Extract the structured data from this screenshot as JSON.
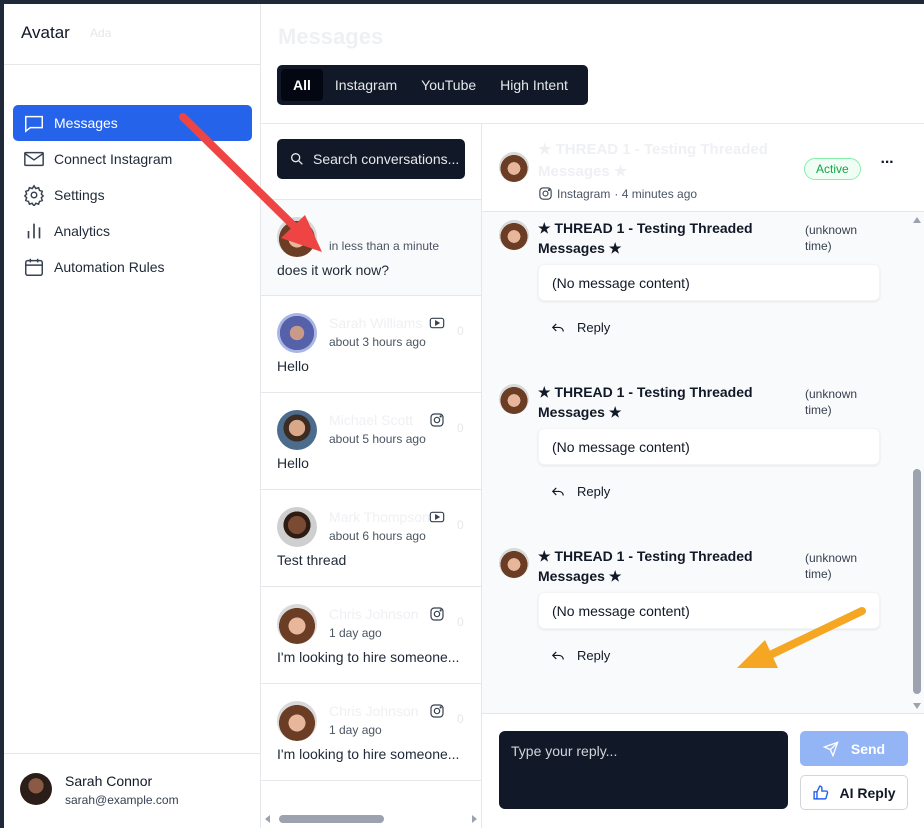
{
  "sidebar": {
    "brand": "Avatar",
    "brand_faint": "Ada",
    "nav": [
      {
        "label": "Messages",
        "icon": "chat-icon",
        "active": true
      },
      {
        "label": "Connect Instagram",
        "icon": "mail-icon"
      },
      {
        "label": "Settings",
        "icon": "gear-icon"
      },
      {
        "label": "Analytics",
        "icon": "bar-chart-icon"
      },
      {
        "label": "Automation Rules",
        "icon": "calendar-icon"
      }
    ],
    "user": {
      "name": "Sarah Connor",
      "email": "sarah@example.com"
    }
  },
  "page": {
    "title": "Messages"
  },
  "filters": [
    "All",
    "Instagram",
    "YouTube",
    "High Intent"
  ],
  "search": {
    "placeholder": "Search conversations..."
  },
  "conversations": [
    {
      "name": "",
      "platform": "",
      "time": "in less than a minute",
      "preview": "does it work now?",
      "count": ""
    },
    {
      "name": "Sarah Williams",
      "platform": "youtube-icon",
      "time": "about 3 hours ago",
      "preview": "Hello",
      "count": "0"
    },
    {
      "name": "Michael Scott",
      "platform": "instagram-icon",
      "time": "about 5 hours ago",
      "preview": "Hello",
      "count": "0"
    },
    {
      "name": "Mark Thompson",
      "platform": "youtube-icon",
      "time": "about 6 hours ago",
      "preview": "Test thread",
      "count": "0"
    },
    {
      "name": "Chris Johnson",
      "platform": "instagram-icon",
      "time": "1 day ago",
      "preview": "I'm looking to hire someone...",
      "count": "0"
    },
    {
      "name": "Chris Johnson",
      "platform": "instagram-icon",
      "time": "1 day ago",
      "preview": "I'm looking to hire someone...",
      "count": "0"
    }
  ],
  "thread": {
    "title": "★ THREAD 1 - Testing Threaded Messages ★",
    "platform": "Instagram",
    "time": "· 4 minutes ago",
    "status": "Active",
    "more": "···",
    "messages": [
      {
        "title": "★ THREAD 1 - Testing Threaded Messages ★",
        "time": "(unknown time)",
        "content": "(No message content)",
        "reply": "Reply"
      },
      {
        "title": "★ THREAD 1 - Testing Threaded Messages ★",
        "time": "(unknown time)",
        "content": "(No message content)",
        "reply": "Reply"
      },
      {
        "title": "★ THREAD 1 - Testing Threaded Messages ★",
        "time": "(unknown time)",
        "content": "(No message content)",
        "reply": "Reply"
      }
    ]
  },
  "composer": {
    "placeholder": "Type your reply...",
    "send": "Send",
    "ai_reply": "AI Reply"
  },
  "colors": {
    "accent": "#2563eb",
    "dark": "#111827",
    "status_green": "#16a34a",
    "arrow_red": "#ef4444",
    "arrow_orange": "#f5a623"
  }
}
